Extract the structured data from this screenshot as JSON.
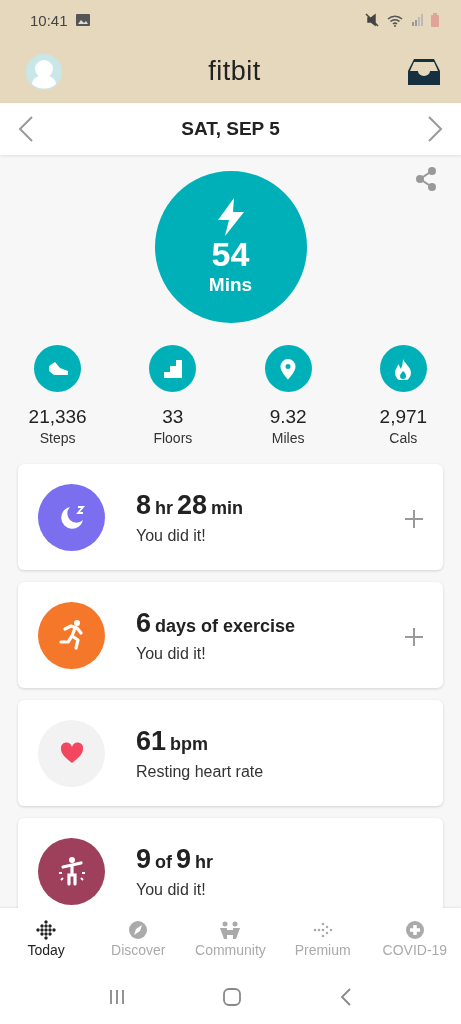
{
  "status_bar": {
    "time": "10:41"
  },
  "header": {
    "title": "fitbit"
  },
  "date_bar": {
    "date": "SAT, SEP 5"
  },
  "active_minutes": {
    "value": "54",
    "unit": "Mins"
  },
  "stats": [
    {
      "kind": "steps",
      "value": "21,336",
      "label": "Steps"
    },
    {
      "kind": "floors",
      "value": "33",
      "label": "Floors"
    },
    {
      "kind": "distance",
      "value": "9.32",
      "label": "Miles"
    },
    {
      "kind": "calories",
      "value": "2,971",
      "label": "Cals"
    }
  ],
  "cards": [
    {
      "kind": "sleep",
      "color": "#7b6ff0",
      "headline": [
        {
          "text": "8",
          "kind": "value"
        },
        {
          "text": "hr",
          "kind": "unit"
        },
        {
          "text": "28",
          "kind": "value"
        },
        {
          "text": "min",
          "kind": "unit"
        }
      ],
      "subtitle": "You did it!",
      "add_button": true
    },
    {
      "kind": "exercise",
      "color": "#f5782a",
      "headline": [
        {
          "text": "6",
          "kind": "value"
        },
        {
          "text": "days of exercise",
          "kind": "unit"
        }
      ],
      "subtitle": "You did it!",
      "add_button": true
    },
    {
      "kind": "heart",
      "color": "#f2f2f3",
      "headline": [
        {
          "text": "61",
          "kind": "value"
        },
        {
          "text": "bpm",
          "kind": "unit"
        }
      ],
      "subtitle": "Resting heart rate",
      "add_button": false
    },
    {
      "kind": "hourly",
      "color": "#9e3f5c",
      "headline": [
        {
          "text": "9",
          "kind": "value"
        },
        {
          "text": "of",
          "kind": "unit"
        },
        {
          "text": "9",
          "kind": "value"
        },
        {
          "text": "hr",
          "kind": "unit"
        }
      ],
      "subtitle": "You did it!",
      "add_button": false
    }
  ],
  "tabs": [
    {
      "kind": "today",
      "label": "Today",
      "selected": true
    },
    {
      "kind": "discover",
      "label": "Discover",
      "selected": false
    },
    {
      "kind": "community",
      "label": "Community",
      "selected": false
    },
    {
      "kind": "premium",
      "label": "Premium",
      "selected": false
    },
    {
      "kind": "covid",
      "label": "COVID-19",
      "selected": false
    }
  ]
}
